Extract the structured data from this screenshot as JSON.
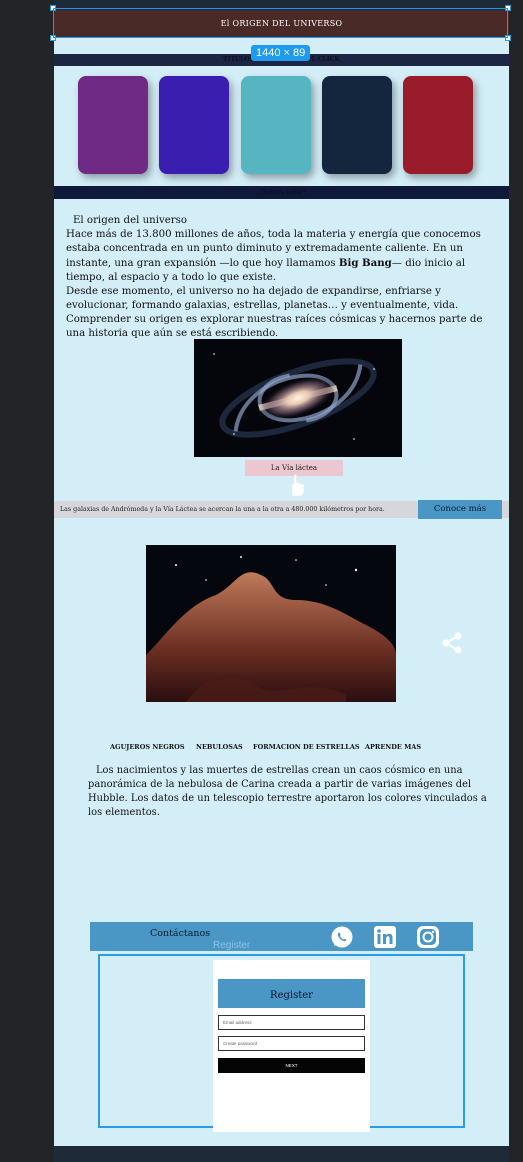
{
  "header": {
    "title": "El ORIGEN DEL UNIVERSO"
  },
  "editor": {
    "dimension_badge": "1440 × 89"
  },
  "nav": {
    "text": "TITULOS POR SECCION              EL CLICK"
  },
  "cards": {
    "colors": [
      "#6e2a84",
      "#3a1eb0",
      "#56b5c0",
      "#14263e",
      "#9a1c2a"
    ]
  },
  "faq": {
    "text": "¿Quieres saber?"
  },
  "intro": {
    "title": "El origen del universo",
    "p1_before": "Hace más de 13.800 millones de años, toda la materia y energía que conocemos estaba concentrada en un punto diminuto y extremadamente caliente. En un instante, una gran expansión —lo que hoy llamamos ",
    "p1_bold": "Big Bang",
    "p1_after": "— dio inicio al tiempo, al espacio y a todo lo que existe.",
    "p2": "Desde ese momento, el universo no ha dejado de expandirse, enfriarse y evolucionar, formando galaxias, estrellas, planetas… y eventualmente, vida. Comprender su origen es explorar nuestras raíces cósmicas y hacernos parte de una historia que aún se está escribiendo."
  },
  "galaxy_button": {
    "label": "La Vía láctea"
  },
  "ticker": {
    "text": "Las galaxias de Andrómeda y la Vía Láctea se acercan la una a la otra a 480.000 kilómetros por hora.",
    "cta": "Conoce más"
  },
  "menu": {
    "items": [
      "AGUJEROS NEGROS",
      "NEBULOSAS",
      "FORMACION DE ESTRELLAS",
      "APRENDE MAS"
    ]
  },
  "nebula_text": "Los nacimientos y las muertes de estrellas crean un caos cósmico en una panorámica de la nebulosa de Carina creada a partir de varias imágenes del Hubble. Los datos de un telescopio terrestre aportaron los colores vinculados a los elementos.",
  "contact": {
    "label": "Contáctanos"
  },
  "register": {
    "ghost_label": "Register",
    "title": "Register",
    "email_placeholder": "Email address",
    "password_placeholder": "Create password",
    "next_label": "NEXT"
  },
  "colors": {
    "header_bg": "#4a2a26",
    "accent": "#4a97c6",
    "page_bg": "#d4eef8",
    "selection": "#1e9bf0"
  }
}
